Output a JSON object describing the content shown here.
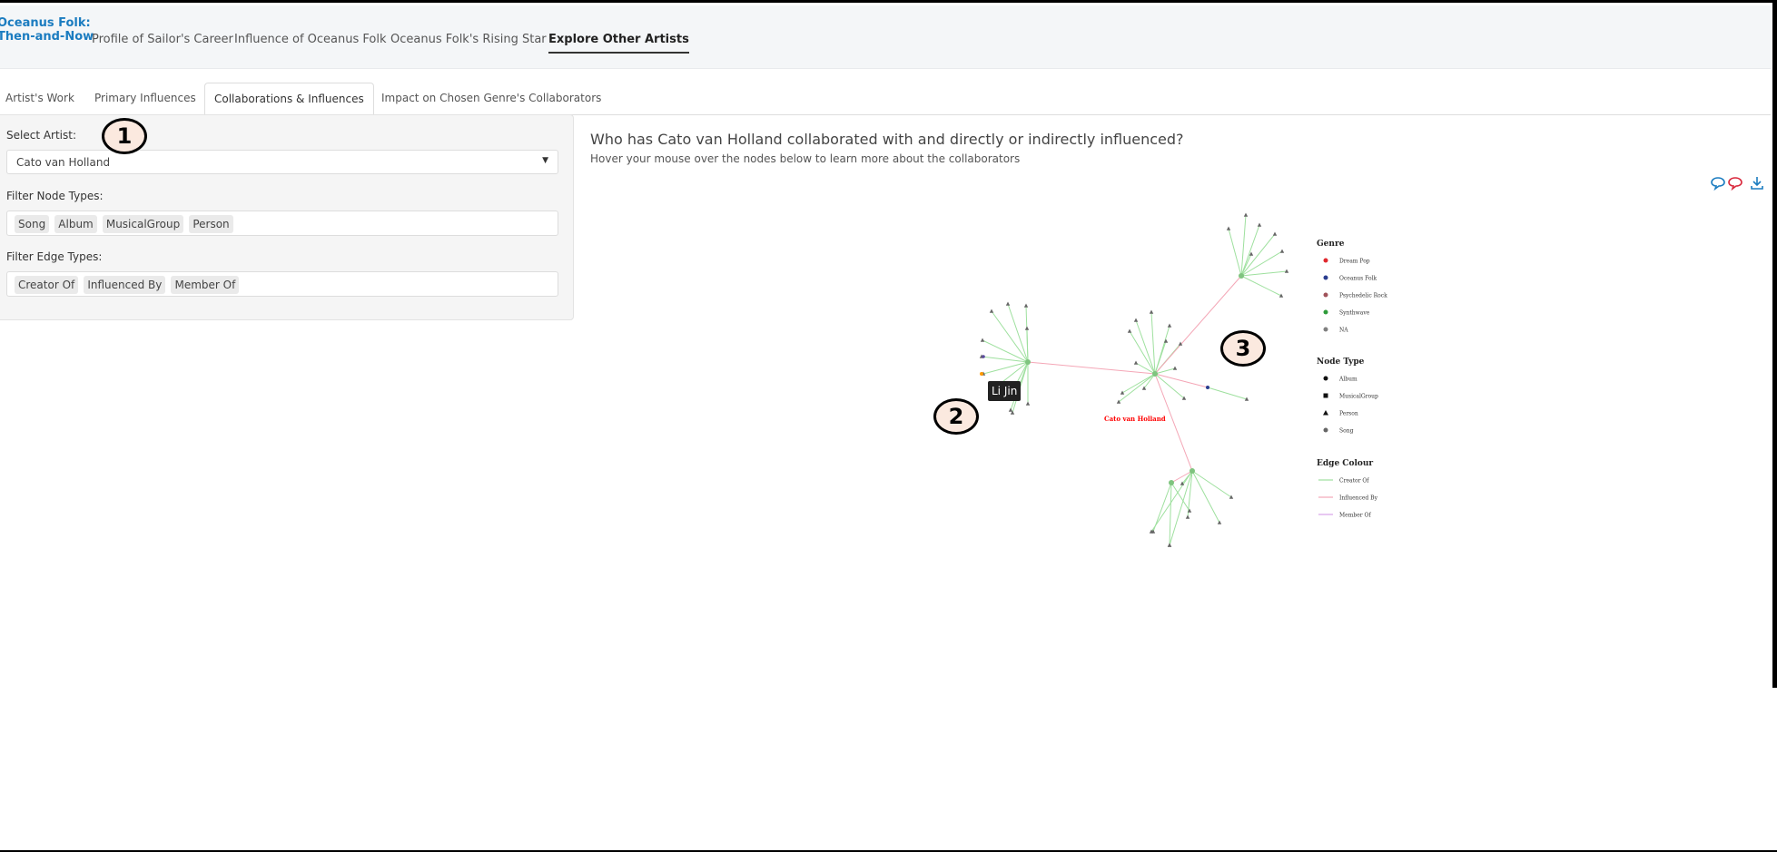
{
  "brand": {
    "line1": "Oceanus Folk:",
    "line2": "Then-and-Now"
  },
  "nav": {
    "items": [
      "Profile of Sailor's Career",
      "Influence of Oceanus Folk",
      "Oceanus Folk's Rising Star",
      "Explore Other Artists"
    ],
    "active": "Explore Other Artists"
  },
  "subtabs": {
    "items": [
      "Artist's Work",
      "Primary Influences",
      "Collaborations & Influences",
      "Impact on Chosen Genre's Collaborators"
    ],
    "active": "Collaborations & Influences"
  },
  "sidebar": {
    "select_artist_label": "Select Artist:",
    "select_artist_value": "Cato van Holland",
    "node_types_label": "Filter Node Types:",
    "node_types": [
      "Song",
      "Album",
      "MusicalGroup",
      "Person"
    ],
    "edge_types_label": "Filter Edge Types:",
    "edge_types": [
      "Creator Of",
      "Influenced By",
      "Member Of"
    ]
  },
  "callouts": [
    "1",
    "2",
    "3"
  ],
  "main": {
    "title": "Who has Cato van Holland collaborated with and directly or indirectly influenced?",
    "subtitle": "Hover your mouse over the nodes below to learn more about the collaborators"
  },
  "toolbar_icons": [
    "comment-icon",
    "comment-alt-icon",
    "download-icon"
  ],
  "tooltip": "Li Jin",
  "graph": {
    "center_label": "Cato van Holland",
    "center_label_color": "#ff0000",
    "edge_colors": {
      "creator_of": "#9ee09e",
      "influenced_by": "#f4a6b6",
      "member_of": "#d9a3e8"
    },
    "legend": {
      "genre_title": "Genre",
      "genres": [
        {
          "name": "Dream Pop",
          "color": "#e0282e"
        },
        {
          "name": "Oceanus Folk",
          "color": "#2a3d8f"
        },
        {
          "name": "Psychedelic Rock",
          "color": "#a0525a"
        },
        {
          "name": "Synthwave",
          "color": "#2e9b3a"
        },
        {
          "name": "NA",
          "color": "#808080"
        }
      ],
      "node_type_title": "Node Type",
      "node_types": [
        {
          "name": "Album",
          "shape": "circle"
        },
        {
          "name": "MusicalGroup",
          "shape": "square"
        },
        {
          "name": "Person",
          "shape": "triangle"
        },
        {
          "name": "Song",
          "shape": "circle"
        }
      ],
      "edge_title": "Edge Colour",
      "edges": [
        {
          "name": "Creator Of",
          "color": "#9ee09e"
        },
        {
          "name": "Influenced By",
          "color": "#f4a6b6"
        },
        {
          "name": "Member Of",
          "color": "#d9a3e8"
        }
      ]
    }
  }
}
